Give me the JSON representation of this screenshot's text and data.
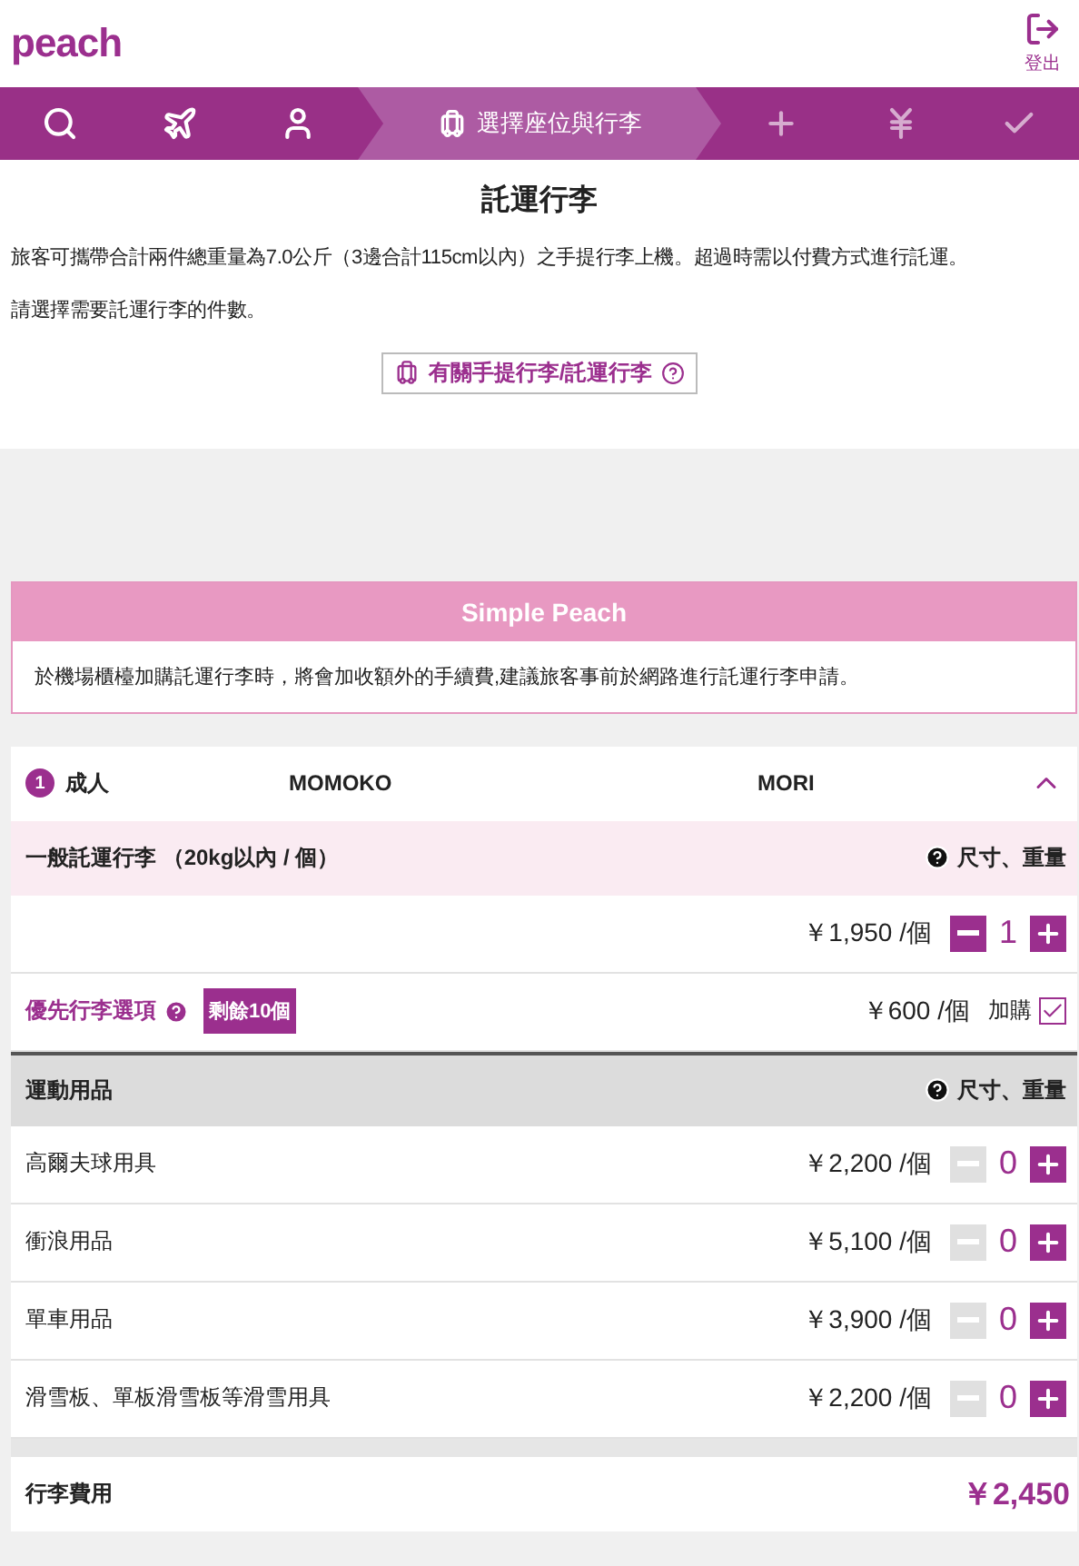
{
  "header": {
    "logo": "peach",
    "logout": "登出"
  },
  "steps": [
    {
      "kind": "search",
      "selected": false
    },
    {
      "kind": "flight",
      "selected": false
    },
    {
      "kind": "passenger",
      "selected": false
    },
    {
      "kind": "seat",
      "label": "選擇座位與行李",
      "selected": true
    },
    {
      "kind": "options",
      "selected": false
    },
    {
      "kind": "payment",
      "selected": false
    },
    {
      "kind": "confirm",
      "selected": false
    }
  ],
  "intro": {
    "title": "託運行李",
    "paragraphs": [
      "旅客可攜帶合計兩件總重量為7.0公斤（3邊合計115cm以內）之手提行李上機。超過時需以付費方式進行託運。",
      "請選擇需要託運行李的件數。"
    ],
    "link": "有關手提行李/託運行李"
  },
  "notice": {
    "title": "Simple Peach",
    "text": "於機場櫃檯加購託運行李時，將會加收額外的手續費,建議旅客事前於網路進行託運行李申請。"
  },
  "passenger": {
    "number": "1",
    "type": "成人",
    "first_name": "MOMOKO",
    "last_name": "MORI",
    "expanded": true,
    "groups": [
      {
        "title": "一般託運行李 （20kg以內 / 個）",
        "kind": "highlight",
        "help": "尺寸、重量",
        "items": [
          {
            "kind": "stepper",
            "price": "￥1,950 /個",
            "count": "1",
            "minus_disabled": false
          },
          {
            "kind": "option",
            "name": "優先行李選項",
            "badge": "剩餘10個",
            "price": "￥600 /個",
            "check_label": "加購",
            "checked": true
          }
        ]
      },
      {
        "title": "運動用品",
        "kind": "shaded",
        "help": "尺寸、重量",
        "items": [
          {
            "kind": "stepper",
            "name": "高爾夫球用具",
            "price": "￥2,200 /個",
            "count": "0",
            "minus_disabled": true
          },
          {
            "kind": "stepper",
            "name": "衝浪用品",
            "price": "￥5,100 /個",
            "count": "0",
            "minus_disabled": true
          },
          {
            "kind": "stepper",
            "name": "單車用品",
            "price": "￥3,900 /個",
            "count": "0",
            "minus_disabled": true
          },
          {
            "kind": "stepper",
            "name": "滑雪板、單板滑雪板等滑雪用具",
            "price": "￥2,200 /個",
            "count": "0",
            "minus_disabled": true
          }
        ]
      }
    ]
  },
  "total": {
    "label": "行李費用",
    "value": "￥2,450"
  }
}
